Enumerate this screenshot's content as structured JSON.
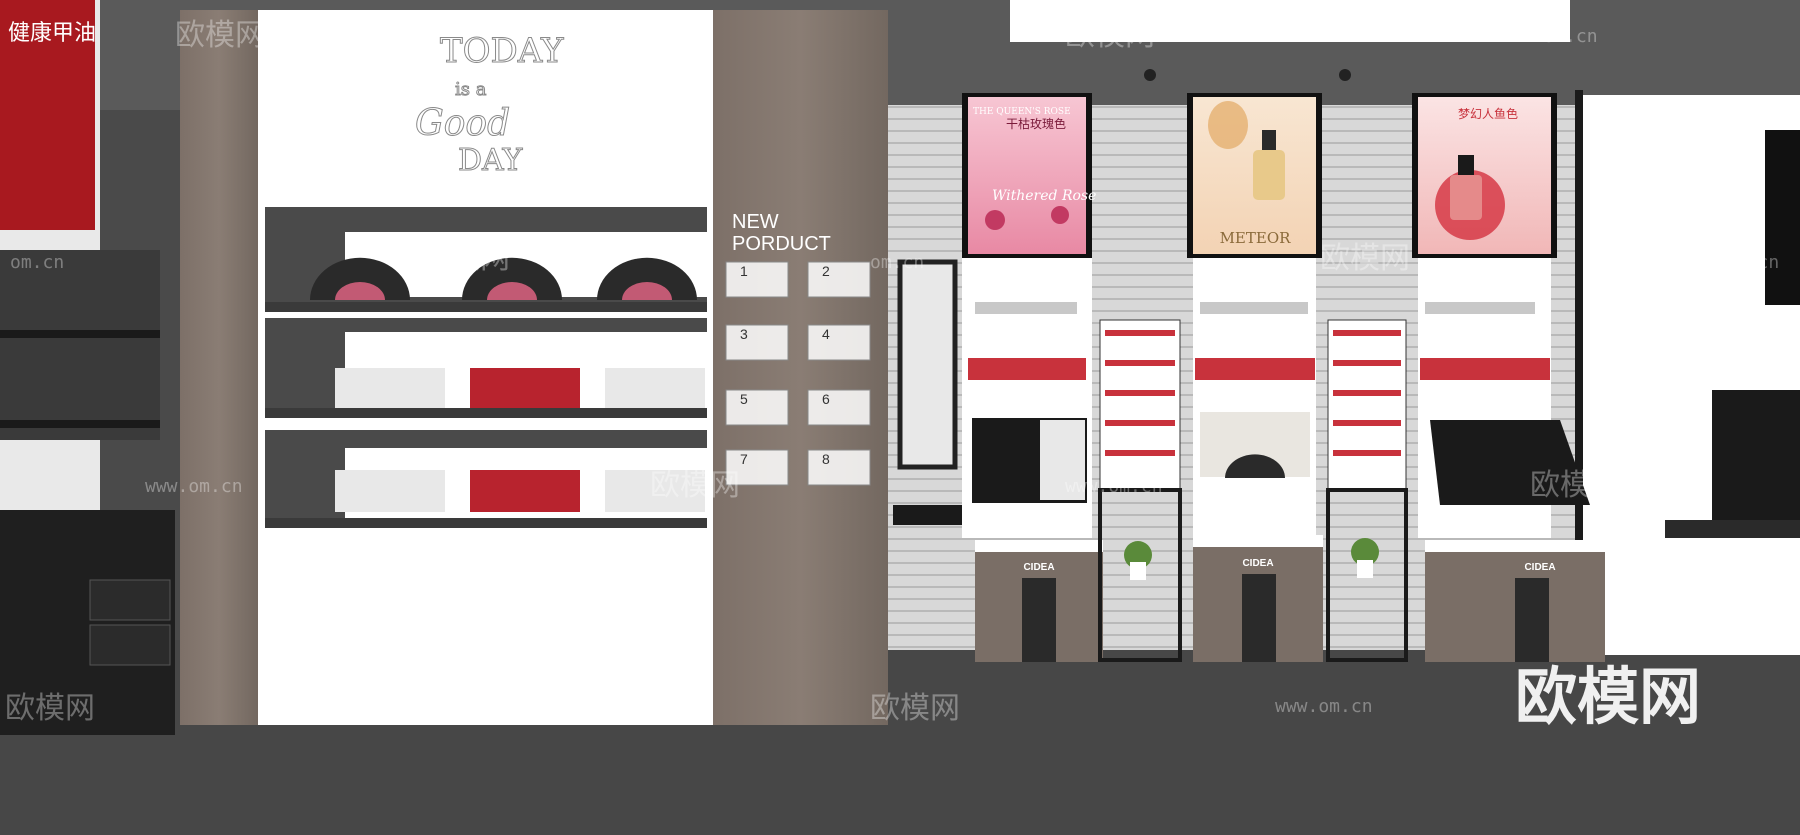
{
  "scene": {
    "wall_script": [
      "TODAY",
      "is a",
      "Good",
      "DAY"
    ],
    "new_product": {
      "line1": "NEW",
      "line2": "PORDUCT"
    },
    "sample_numbers": [
      "1",
      "2",
      "3",
      "4",
      "5",
      "6",
      "7",
      "8"
    ],
    "posters": {
      "left": {
        "headline": "THE QUEEN'S ROSE",
        "chinese": "干枯玫瑰色",
        "script": "Withered Rose"
      },
      "center": {
        "headline": "METEOR"
      },
      "right": {
        "chinese": "梦幻人鱼色"
      }
    },
    "counter_brand": "CIDEA",
    "left_sign": "健康甲油"
  },
  "watermark": {
    "brand": "欧模网",
    "url": "www.om.cn",
    "short": "om.cn"
  },
  "colors": {
    "floor": "#4a4a4a",
    "wall_white": "#ffffff",
    "wood": "#7a6e66",
    "slatwall": "#d9d9d9",
    "frame_black": "#1a1a1a",
    "pink": "#f0a6b8",
    "lipstick_red": "#c8323c"
  }
}
